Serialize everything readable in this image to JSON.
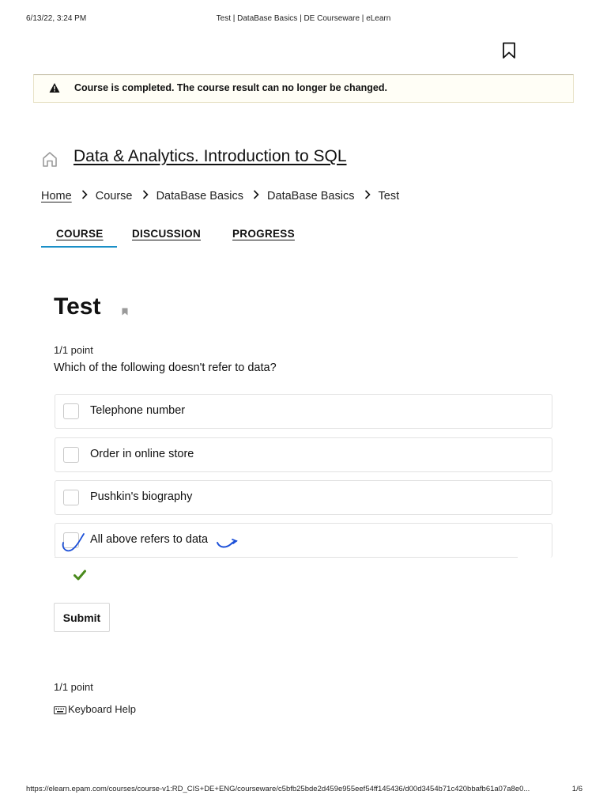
{
  "print_header": {
    "datetime": "6/13/22, 3:24 PM",
    "page_title": "Test | DataBase Basics | DE Courseware | eLearn"
  },
  "alert": {
    "icon": "warning-icon",
    "text": "Course is completed. The course result can no longer be changed."
  },
  "course": {
    "title": "Data & Analytics. Introduction to SQL"
  },
  "breadcrumb": {
    "items": [
      "Home",
      "Course",
      "DataBase Basics",
      "DataBase Basics",
      "Test"
    ]
  },
  "tabs": [
    {
      "label": "COURSE",
      "active": true
    },
    {
      "label": "DISCUSSION",
      "active": false
    },
    {
      "label": "PROGRESS",
      "active": false
    }
  ],
  "test": {
    "title": "Test",
    "points": "1/1 point",
    "question": "Which of the following doesn't refer to data?",
    "options": [
      {
        "label": "Telephone number",
        "checked": false
      },
      {
        "label": "Order in online store",
        "checked": false
      },
      {
        "label": "Pushkin's biography",
        "checked": false
      },
      {
        "label": "All above refers to data",
        "checked": true
      }
    ],
    "submit_label": "Submit",
    "footer_points": "1/1 point",
    "keyboard_help": "Keyboard Help"
  },
  "colors": {
    "accent": "#1a8fc7",
    "correct": "#4a8a1d",
    "pen": "#1b4fd8"
  },
  "print_footer": {
    "url": "https://elearn.epam.com/courses/course-v1:RD_CIS+DE+ENG/courseware/c5bfb25bde2d459e955eef54ff145436/d00d3454b71c420bbafb61a07a8e0...",
    "page": "1/6"
  }
}
